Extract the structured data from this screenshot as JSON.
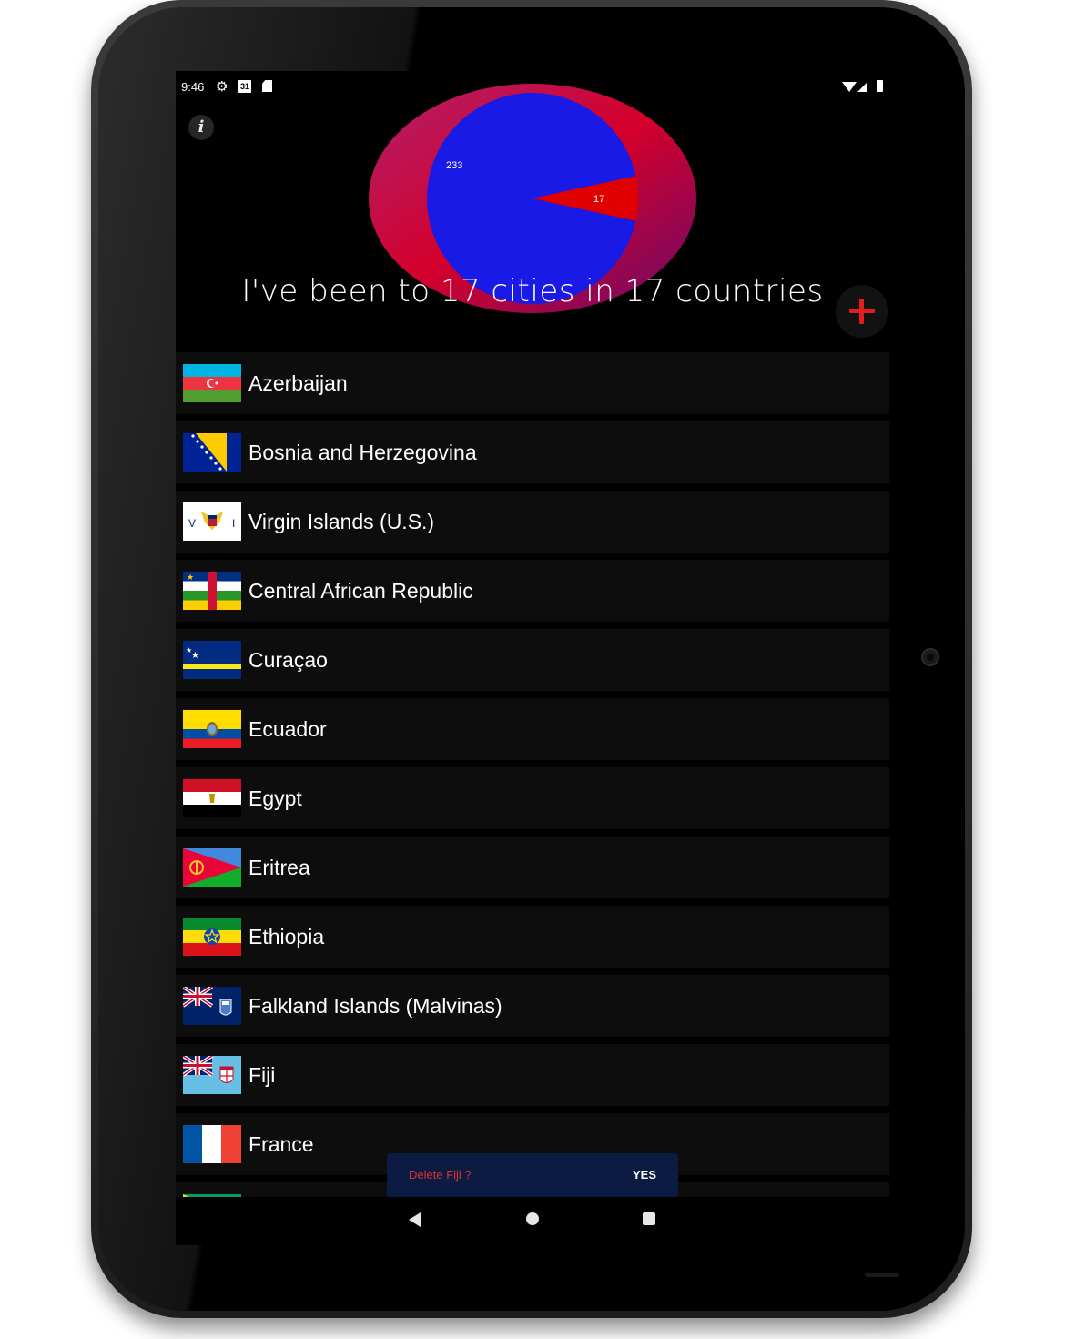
{
  "status_bar": {
    "time": "9:46",
    "calendar_day": "31",
    "icons": [
      "gear-icon",
      "calendar-icon",
      "sd-card-icon",
      "wifi-icon",
      "cell-signal-icon",
      "battery-icon"
    ]
  },
  "header": {
    "info_button": "i",
    "headline": "I've been to 17 cities in 17 countries",
    "add_button_icon": "plus-icon"
  },
  "chart_data": {
    "type": "pie",
    "categories": [
      "not visited",
      "visited"
    ],
    "values": [
      233,
      17
    ],
    "labels": [
      "233",
      "17"
    ],
    "colors": [
      "#1a1ae6",
      "#e00000"
    ]
  },
  "countries": [
    {
      "name": "Azerbaijan",
      "flag": "azerbaijan-flag-icon"
    },
    {
      "name": "Bosnia and Herzegovina",
      "flag": "bosnia-flag-icon"
    },
    {
      "name": "Virgin Islands (U.S.)",
      "flag": "us-virgin-islands-flag-icon"
    },
    {
      "name": "Central African Republic",
      "flag": "central-african-republic-flag-icon"
    },
    {
      "name": "Curaçao",
      "flag": "curacao-flag-icon"
    },
    {
      "name": "Ecuador",
      "flag": "ecuador-flag-icon"
    },
    {
      "name": "Egypt",
      "flag": "egypt-flag-icon"
    },
    {
      "name": "Eritrea",
      "flag": "eritrea-flag-icon"
    },
    {
      "name": "Ethiopia",
      "flag": "ethiopia-flag-icon"
    },
    {
      "name": "Falkland Islands (Malvinas)",
      "flag": "falkland-flag-icon"
    },
    {
      "name": "Fiji",
      "flag": "fiji-flag-icon"
    },
    {
      "name": "France",
      "flag": "france-flag-icon"
    },
    {
      "name": "",
      "flag": "gabon-flag-icon"
    }
  ],
  "snackbar": {
    "message": "Delete Fiji ?",
    "action": "YES"
  },
  "navigation": {
    "back": "back-icon",
    "home": "home-icon",
    "recents": "recents-icon"
  },
  "colors": {
    "accent": "#e01e1e",
    "pie_visited": "#e00000",
    "pie_remaining": "#1a1ae6",
    "snackbar_bg": "#0b1b42",
    "row_bg": "#0d0d0d"
  }
}
